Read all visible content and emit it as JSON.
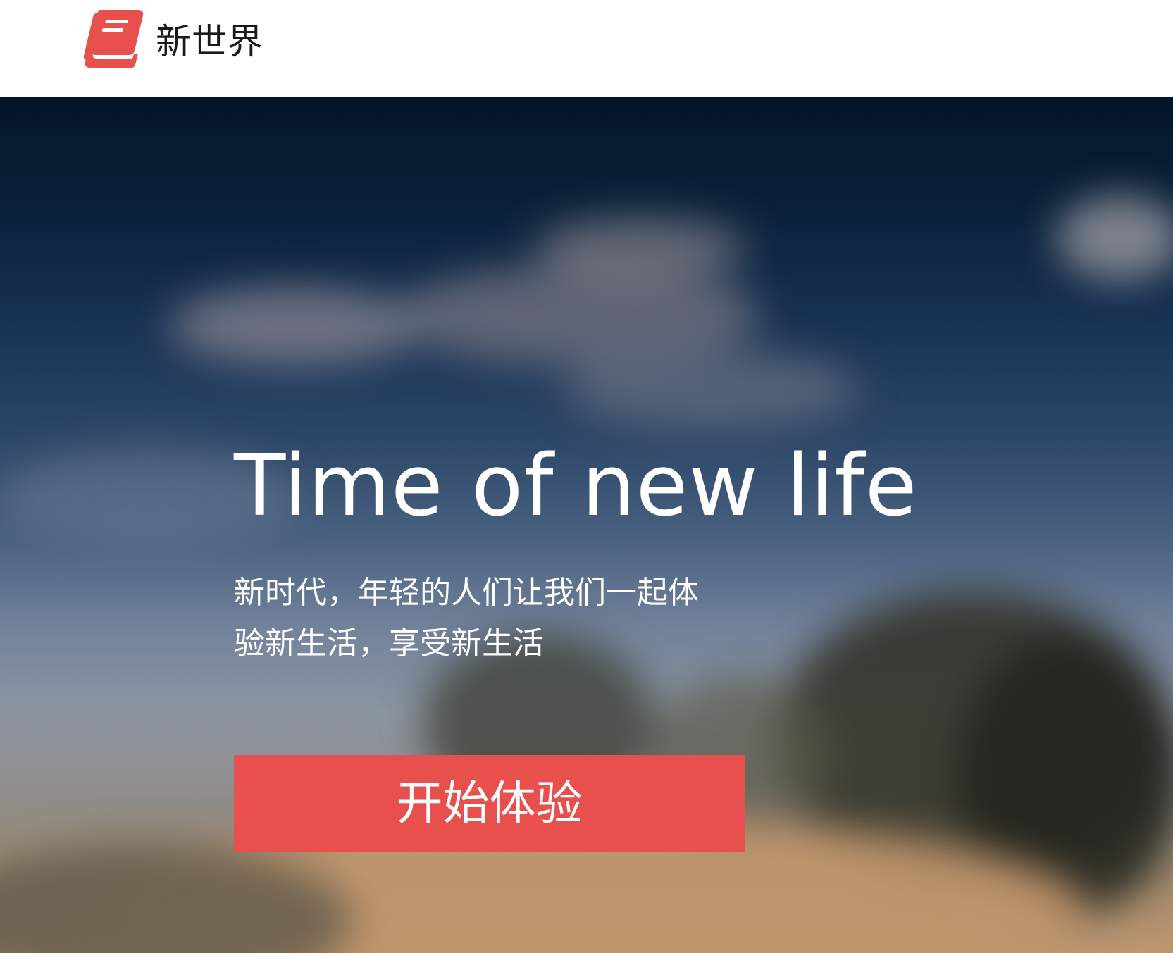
{
  "header": {
    "logo_icon": "book-icon",
    "brand_name": "新世界",
    "brand_color": "#e8504e"
  },
  "hero": {
    "title": "Time of new life",
    "subtitle_line1": "新时代，年轻的人们让我们一起体",
    "subtitle_line2": "验新生活，享受新生活",
    "cta_label": "开始体验",
    "cta_color": "#e8504e"
  }
}
